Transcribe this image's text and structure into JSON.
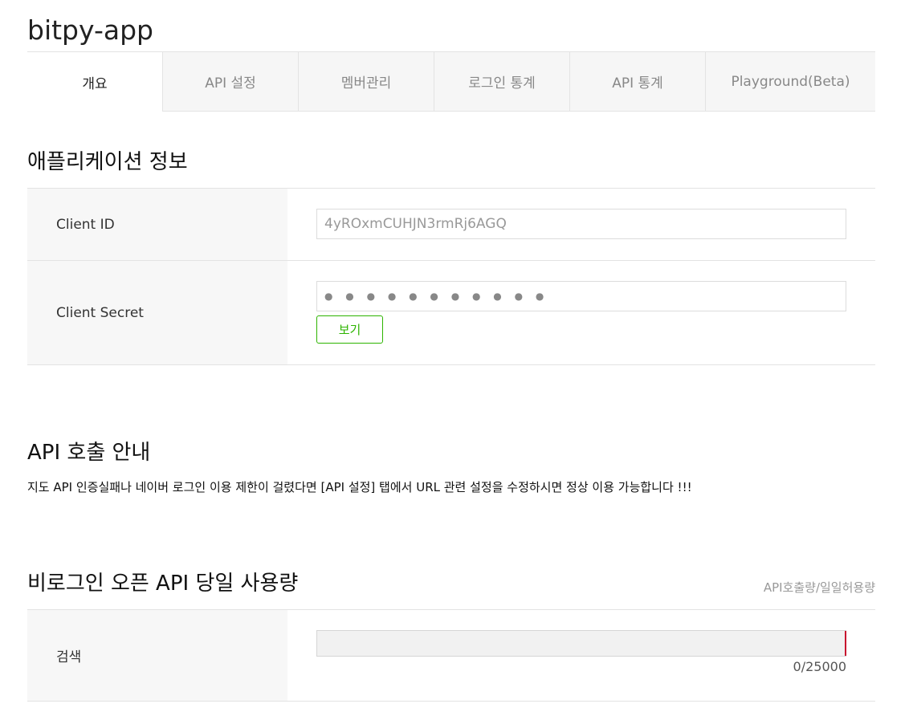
{
  "app": {
    "title": "bitpy-app"
  },
  "tabs": [
    {
      "label": "개요",
      "active": true
    },
    {
      "label": "API 설정",
      "active": false
    },
    {
      "label": "멤버관리",
      "active": false
    },
    {
      "label": "로그인 통계",
      "active": false
    },
    {
      "label": "API 통계",
      "active": false
    },
    {
      "label": "Playground(Beta)",
      "active": false
    }
  ],
  "app_info": {
    "title": "애플리케이션 정보",
    "client_id_label": "Client ID",
    "client_id_value": "4yROxmCUHJN3rmRj6AGQ",
    "client_secret_label": "Client Secret",
    "client_secret_masked": "● ● ● ● ● ● ● ● ● ● ●",
    "view_button_label": "보기"
  },
  "api_notice": {
    "title": "API 호출 안내",
    "text": "지도 API 인증실패나 네이버 로그인 이용 제한이 걸렸다면 [API 설정] 탭에서 URL 관련 설정을 수정하시면 정상 이용 가능합니다 !!!"
  },
  "usage": {
    "title": "비로그인 오픈 API 당일 사용량",
    "unit_label": "API호출량/일일허용량",
    "items": [
      {
        "label": "검색",
        "used": 0,
        "limit": 25000,
        "count_text": "0/25000"
      }
    ]
  },
  "colors": {
    "accent_green": "#2db400",
    "limit_red": "#c8102e"
  }
}
